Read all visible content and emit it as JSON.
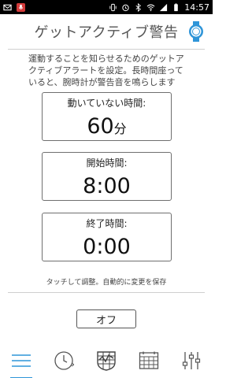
{
  "status_bar": {
    "time": "14:57",
    "left_icons": [
      "mail-icon",
      "mic-off-icon"
    ],
    "right_icons": [
      "vibrate-icon",
      "alarm-icon",
      "bluetooth-icon",
      "wifi-icon",
      "signal-icon",
      "battery-icon"
    ]
  },
  "header": {
    "title": "ゲットアクティブ警告",
    "watch_icon": "watch-icon",
    "accent_color": "#2f95d8"
  },
  "description": "運動することを知らせるためのゲットアクティブアラートを設定。長時間座っていると、腕時計が警告音を鳴らします",
  "inactive_card": {
    "label": "動いていない時間:",
    "value": "60",
    "unit": "分"
  },
  "start_card": {
    "label": "開始時間:",
    "value": "8:00"
  },
  "end_card": {
    "label": "終了時間:",
    "value": "0:00"
  },
  "note": "タッチして調整。自動的に変更を保存",
  "toggle_button": {
    "label": "オフ"
  },
  "nav": [
    {
      "name": "menu-icon",
      "active": true
    },
    {
      "name": "clock-icon",
      "active": false
    },
    {
      "name": "activity-icon",
      "active": false
    },
    {
      "name": "calendar-icon",
      "active": false
    },
    {
      "name": "settings-sliders-icon",
      "active": false
    }
  ]
}
